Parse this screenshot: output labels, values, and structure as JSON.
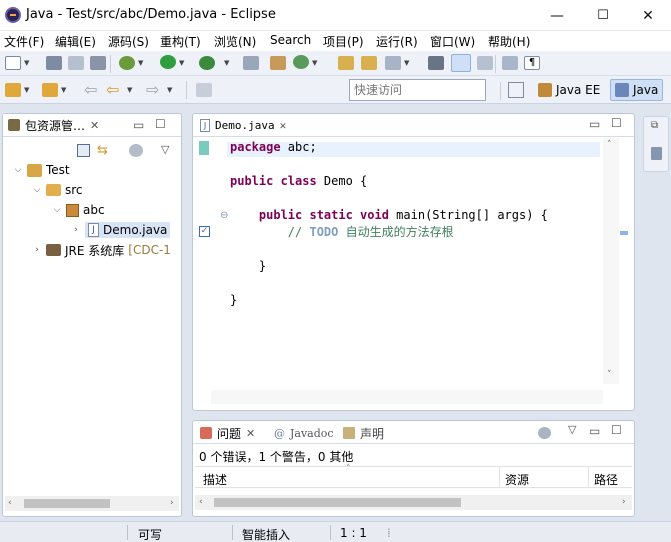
{
  "window": {
    "title": "Java  -  Test/src/abc/Demo.java  -  Eclipse",
    "min_glyph": "—",
    "max_glyph": "☐",
    "close_glyph": "✕"
  },
  "menu": [
    "文件(F)",
    "编辑(E)",
    "源码(S)",
    "重构(T)",
    "浏览(N)",
    "Search",
    "项目(P)",
    "运行(R)",
    "窗口(W)",
    "帮助(H)"
  ],
  "toolbar": {
    "quick_access_placeholder": "快速访问",
    "perspective_java_ee": "Java EE",
    "perspective_java": "Java"
  },
  "explorer": {
    "tab_label": "包资源管…",
    "tree": [
      {
        "label": "Test",
        "level": 0,
        "expanded": true,
        "icon": "project-icon"
      },
      {
        "label": "src",
        "level": 1,
        "expanded": true,
        "icon": "source-folder-icon"
      },
      {
        "label": "abc",
        "level": 2,
        "expanded": true,
        "icon": "package-icon"
      },
      {
        "label": "Demo.java",
        "level": 3,
        "expanded": false,
        "icon": "java-file-icon",
        "selected": true
      },
      {
        "label": "JRE 系统库",
        "decoration": "[CDC-1",
        "level": 1,
        "expanded": false,
        "icon": "library-icon"
      }
    ]
  },
  "editor": {
    "tab_label": "Demo.java",
    "code": {
      "l1_kw": "package",
      "l1_rest": " abc;",
      "l2_kw": "public class",
      "l2_rest": " Demo {",
      "l3_indent": "    ",
      "l3_kw": "public static void",
      "l3_rest": " main(String[] args) {",
      "l4_indent": "        ",
      "l4_comment": "// ",
      "l4_todo": "TODO",
      "l4_text": " 自动生成的方法存根",
      "l5_text": "    }",
      "l6_text": "}"
    }
  },
  "problems": {
    "tab_problems": "问题",
    "tab_javadoc": "Javadoc",
    "tab_declaration": "声明",
    "summary": "0 个错误，1 个警告，0 其他",
    "columns": [
      "描述",
      "资源",
      "路径"
    ]
  },
  "statusbar": {
    "writable": "可写",
    "insert_mode": "智能插入",
    "position": "1 : 1"
  },
  "colors": {
    "keyword": "#7f0055",
    "comment": "#3f7f5f",
    "todo": "#7f9fbf",
    "selection": "#d6e4f5"
  }
}
